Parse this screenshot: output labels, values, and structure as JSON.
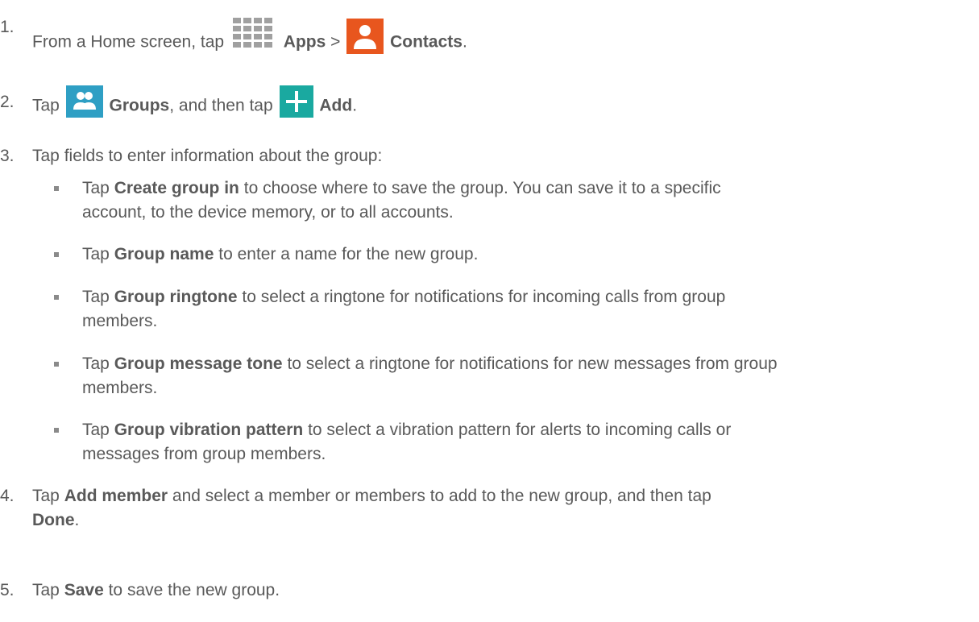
{
  "steps": [
    {
      "num": "1.",
      "pre": "From a Home screen, tap",
      "icon1": "apps-grid-icon",
      "b1": "Apps",
      "sep": ">",
      "icon2": "contacts-icon",
      "b2": "Contacts",
      "post": "."
    },
    {
      "num": "2.",
      "pre": "Tap",
      "icon1": "groups-icon",
      "b1": "Groups",
      "mid": ", and then tap",
      "icon2": "add-plus-icon",
      "b2": "Add",
      "post": "."
    },
    {
      "num": "3.",
      "text": "Tap fields to enter information about the group:"
    },
    {
      "num": "4.",
      "pre": "Tap",
      "b1": "Add member",
      "mid": "and select a member or members to add to the new group, and then tap",
      "b2": "Done",
      "post": "."
    },
    {
      "num": "5.",
      "pre": "Tap",
      "b1": "Save",
      "post": "to save the new group."
    }
  ],
  "bullets": [
    {
      "pre": "Tap",
      "bold": "Create group in",
      "line1": "to choose where to save the group. You can save it to a specific",
      "line2": "account, to the device memory, or to all accounts."
    },
    {
      "pre": "Tap",
      "bold": "Group name",
      "line1": "to enter a name for the new group."
    },
    {
      "pre": "Tap",
      "bold": "Group ringtone",
      "line1": "to select a ringtone for notifications for incoming calls from group",
      "line2": "members."
    },
    {
      "pre": "Tap",
      "bold": "Group message tone",
      "line1": "to select a ringtone for notifications for new messages from group",
      "line2": "members."
    },
    {
      "pre": "Tap",
      "bold": "Group vibration pattern",
      "line1": "to select a vibration pattern for alerts to incoming calls or",
      "line2": "messages from group members."
    }
  ],
  "colors": {
    "text": "#595959",
    "apps_icon": "#a0a0a0",
    "contacts_icon": "#e8561e",
    "groups_icon": "#2e9fc4",
    "add_icon": "#1aa9a0"
  }
}
